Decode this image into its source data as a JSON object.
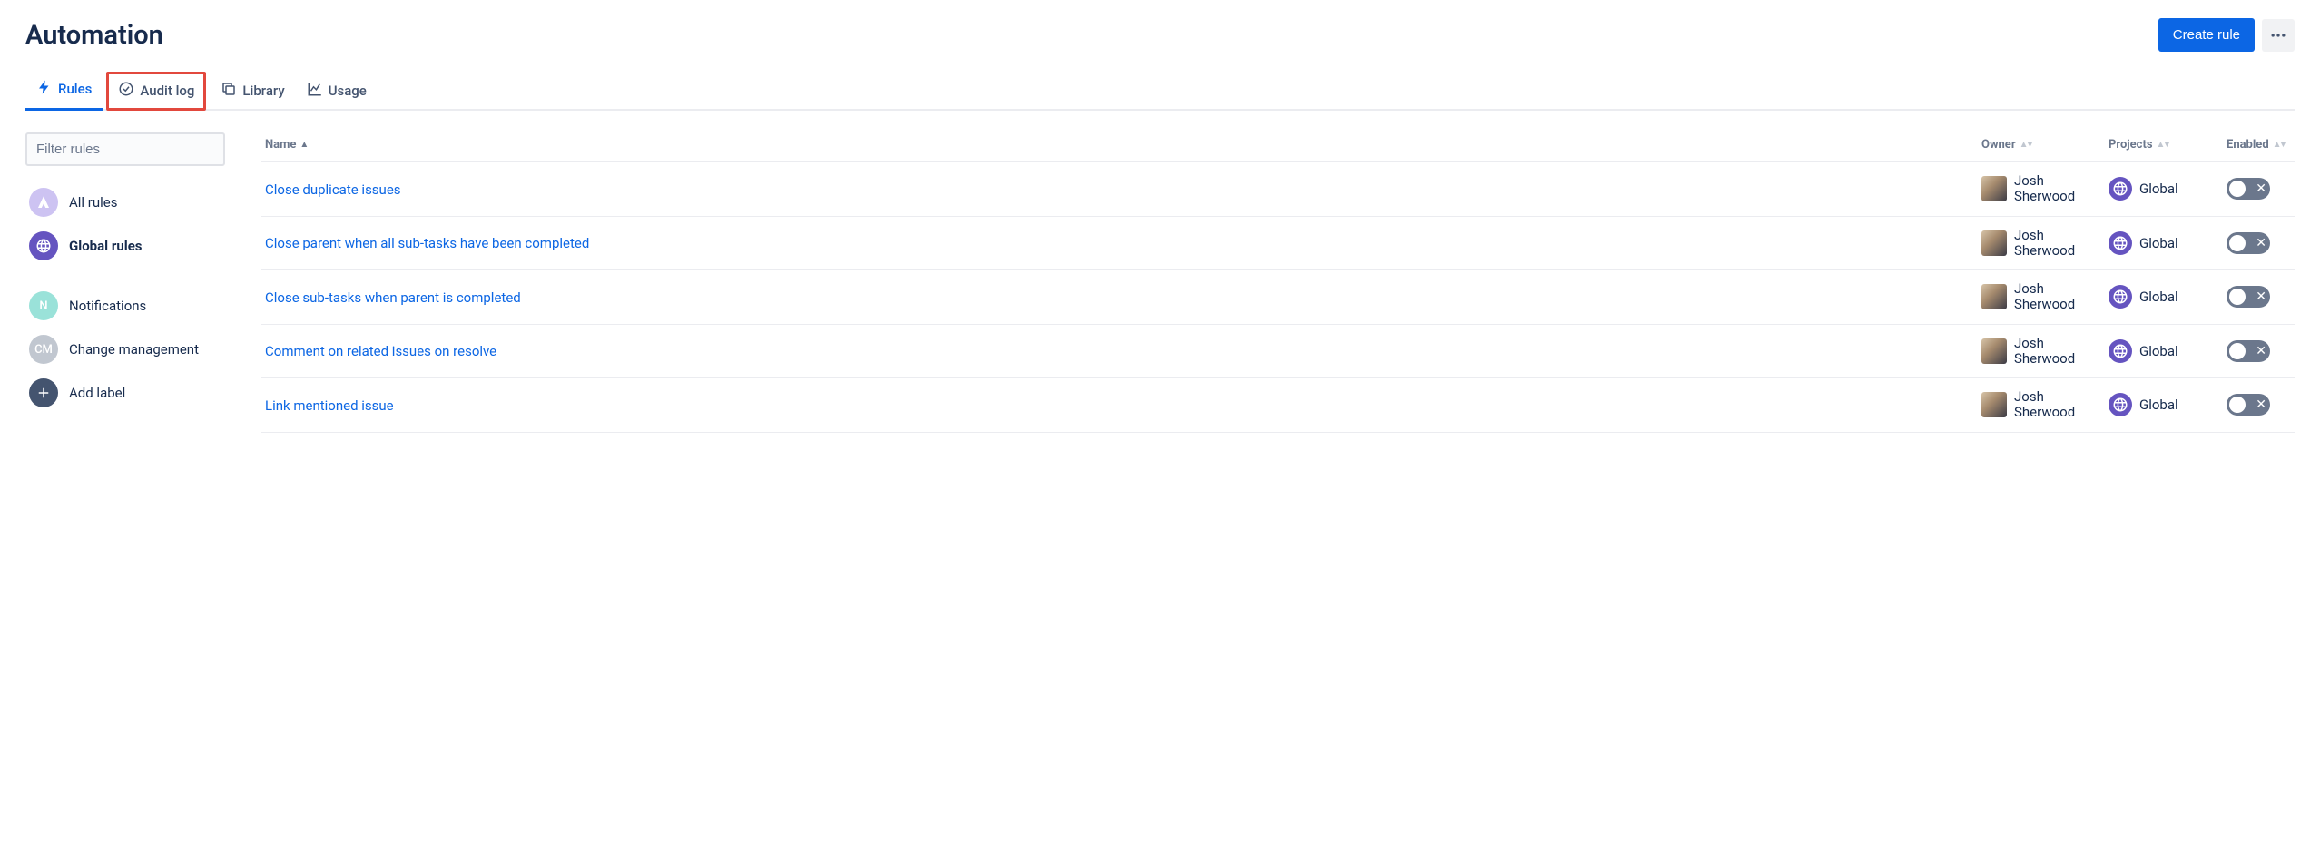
{
  "header": {
    "title": "Automation",
    "create_button": "Create rule"
  },
  "tabs": [
    {
      "id": "rules",
      "label": "Rules",
      "icon": "lightning-icon",
      "active": true,
      "highlighted": false
    },
    {
      "id": "auditlog",
      "label": "Audit log",
      "icon": "check-circle-icon",
      "active": false,
      "highlighted": true
    },
    {
      "id": "library",
      "label": "Library",
      "icon": "copy-icon",
      "active": false,
      "highlighted": false
    },
    {
      "id": "usage",
      "label": "Usage",
      "icon": "chart-icon",
      "active": false,
      "highlighted": false
    }
  ],
  "sidebar": {
    "filter_placeholder": "Filter rules",
    "groups": [
      [
        {
          "id": "all",
          "label": "All rules",
          "icon_bg": "#cdc3f2",
          "icon_type": "logo",
          "selected": false
        },
        {
          "id": "global",
          "label": "Global rules",
          "icon_bg": "#6554c0",
          "icon_type": "globe",
          "selected": true
        }
      ],
      [
        {
          "id": "notif",
          "label": "Notifications",
          "icon_bg": "#9ae2d9",
          "icon_text": "N",
          "selected": false
        },
        {
          "id": "cm",
          "label": "Change management",
          "icon_bg": "#c1c7d0",
          "icon_text": "CM",
          "selected": false
        },
        {
          "id": "add",
          "label": "Add label",
          "icon_bg": "#44546f",
          "icon_type": "plus",
          "selected": false
        }
      ]
    ]
  },
  "table": {
    "columns": {
      "name": "Name",
      "owner": "Owner",
      "projects": "Projects",
      "enabled": "Enabled"
    },
    "rows": [
      {
        "name": "Close duplicate issues",
        "owner": "Josh Sherwood",
        "project": "Global",
        "enabled": false
      },
      {
        "name": "Close parent when all sub-tasks have been completed",
        "owner": "Josh Sherwood",
        "project": "Global",
        "enabled": false
      },
      {
        "name": "Close sub-tasks when parent is completed",
        "owner": "Josh Sherwood",
        "project": "Global",
        "enabled": false
      },
      {
        "name": "Comment on related issues on resolve",
        "owner": "Josh Sherwood",
        "project": "Global",
        "enabled": false
      },
      {
        "name": "Link mentioned issue",
        "owner": "Josh Sherwood",
        "project": "Global",
        "enabled": false
      }
    ]
  }
}
